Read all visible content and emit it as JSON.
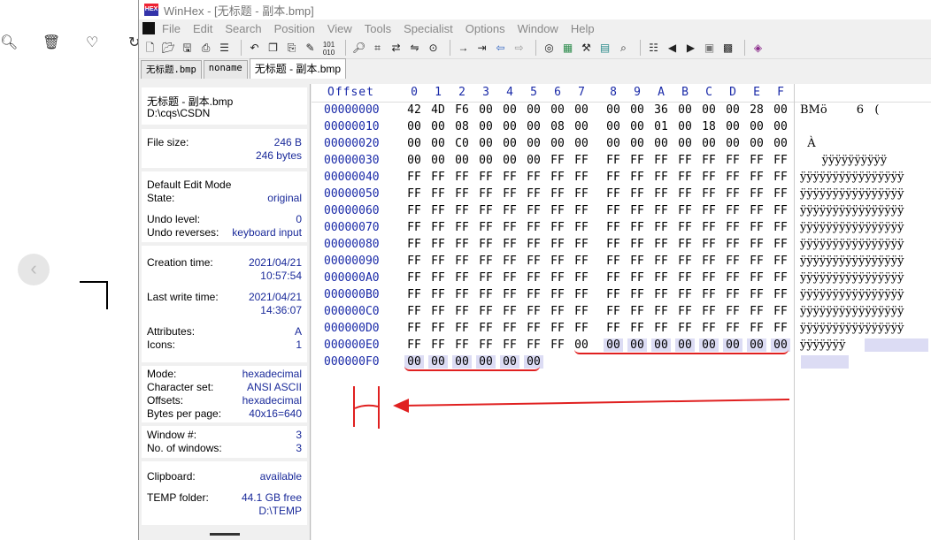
{
  "window": {
    "title": "WinHex - [无标题 - 副本.bmp]"
  },
  "menu": [
    "File",
    "Edit",
    "Search",
    "Position",
    "View",
    "Tools",
    "Specialist",
    "Options",
    "Window",
    "Help"
  ],
  "toolbar_icons": [
    "new-file-icon",
    "open-icon",
    "save-icon",
    "print-icon",
    "properties-icon",
    "undo-icon",
    "copy-icon",
    "paste-icon",
    "write-icon",
    "binary-icon",
    "find-icon",
    "find-hex-icon",
    "replace-icon",
    "replace-hex-icon",
    "find-next-icon",
    "goto-offset-icon",
    "goto-sector-icon",
    "back-icon",
    "forward-icon",
    "disk-icon",
    "ram-icon",
    "tools-icon",
    "calculator-icon",
    "search-icon",
    "hash-icon",
    "prev-icon",
    "next-icon",
    "camera-icon",
    "grid-icon",
    "book-icon"
  ],
  "tabs": [
    "无标题.bmp",
    "noname",
    "无标题 - 副本.bmp"
  ],
  "info": {
    "filename": "无标题 - 副本.bmp",
    "path": "D:\\cqs\\CSDN",
    "file_size_label": "File size:",
    "file_size": "246 B",
    "file_size_bytes": "246 bytes",
    "edit_mode": "Default Edit Mode",
    "state_label": "State:",
    "state": "original",
    "undo_level_label": "Undo level:",
    "undo_level": "0",
    "undo_rev_label": "Undo reverses:",
    "undo_rev": "keyboard input",
    "creation_label": "Creation time:",
    "creation_date": "2021/04/21",
    "creation_time": "10:57:54",
    "lastwrite_label": "Last write time:",
    "lastwrite_date": "2021/04/21",
    "lastwrite_time": "14:36:07",
    "attributes_label": "Attributes:",
    "attributes": "A",
    "icons_label": "Icons:",
    "icons": "1",
    "mode_label": "Mode:",
    "mode": "hexadecimal",
    "charset_label": "Character set:",
    "charset": "ANSI ASCII",
    "offsets_label": "Offsets:",
    "offsets": "hexadecimal",
    "bpp_label": "Bytes per page:",
    "bpp": "40x16=640",
    "window_no_label": "Window #:",
    "window_no": "3",
    "num_windows_label": "No. of windows:",
    "num_windows": "3",
    "clipboard_label": "Clipboard:",
    "clipboard": "available",
    "temp_label": "TEMP folder:",
    "temp_free": "44.1 GB free",
    "temp_path": "D:\\TEMP"
  },
  "hex": {
    "offset_label": "Offset",
    "columns": [
      "0",
      "1",
      "2",
      "3",
      "4",
      "5",
      "6",
      "7",
      "8",
      "9",
      "A",
      "B",
      "C",
      "D",
      "E",
      "F"
    ],
    "rows": [
      {
        "offset": "00000000",
        "bytes": [
          "42",
          "4D",
          "F6",
          "00",
          "00",
          "00",
          "00",
          "00",
          "00",
          "00",
          "36",
          "00",
          "00",
          "00",
          "28",
          "00"
        ],
        "text": "BMö        6   ("
      },
      {
        "offset": "00000010",
        "bytes": [
          "00",
          "00",
          "08",
          "00",
          "00",
          "00",
          "08",
          "00",
          "00",
          "00",
          "01",
          "00",
          "18",
          "00",
          "00",
          "00"
        ],
        "text": ""
      },
      {
        "offset": "00000020",
        "bytes": [
          "00",
          "00",
          "C0",
          "00",
          "00",
          "00",
          "00",
          "00",
          "00",
          "00",
          "00",
          "00",
          "00",
          "00",
          "00",
          "00"
        ],
        "text": "  À"
      },
      {
        "offset": "00000030",
        "bytes": [
          "00",
          "00",
          "00",
          "00",
          "00",
          "00",
          "FF",
          "FF",
          "FF",
          "FF",
          "FF",
          "FF",
          "FF",
          "FF",
          "FF",
          "FF"
        ],
        "text": "      ÿÿÿÿÿÿÿÿÿÿ"
      },
      {
        "offset": "00000040",
        "bytes": [
          "FF",
          "FF",
          "FF",
          "FF",
          "FF",
          "FF",
          "FF",
          "FF",
          "FF",
          "FF",
          "FF",
          "FF",
          "FF",
          "FF",
          "FF",
          "FF"
        ],
        "text": "ÿÿÿÿÿÿÿÿÿÿÿÿÿÿÿÿ"
      },
      {
        "offset": "00000050",
        "bytes": [
          "FF",
          "FF",
          "FF",
          "FF",
          "FF",
          "FF",
          "FF",
          "FF",
          "FF",
          "FF",
          "FF",
          "FF",
          "FF",
          "FF",
          "FF",
          "FF"
        ],
        "text": "ÿÿÿÿÿÿÿÿÿÿÿÿÿÿÿÿ"
      },
      {
        "offset": "00000060",
        "bytes": [
          "FF",
          "FF",
          "FF",
          "FF",
          "FF",
          "FF",
          "FF",
          "FF",
          "FF",
          "FF",
          "FF",
          "FF",
          "FF",
          "FF",
          "FF",
          "FF"
        ],
        "text": "ÿÿÿÿÿÿÿÿÿÿÿÿÿÿÿÿ"
      },
      {
        "offset": "00000070",
        "bytes": [
          "FF",
          "FF",
          "FF",
          "FF",
          "FF",
          "FF",
          "FF",
          "FF",
          "FF",
          "FF",
          "FF",
          "FF",
          "FF",
          "FF",
          "FF",
          "FF"
        ],
        "text": "ÿÿÿÿÿÿÿÿÿÿÿÿÿÿÿÿ"
      },
      {
        "offset": "00000080",
        "bytes": [
          "FF",
          "FF",
          "FF",
          "FF",
          "FF",
          "FF",
          "FF",
          "FF",
          "FF",
          "FF",
          "FF",
          "FF",
          "FF",
          "FF",
          "FF",
          "FF"
        ],
        "text": "ÿÿÿÿÿÿÿÿÿÿÿÿÿÿÿÿ"
      },
      {
        "offset": "00000090",
        "bytes": [
          "FF",
          "FF",
          "FF",
          "FF",
          "FF",
          "FF",
          "FF",
          "FF",
          "FF",
          "FF",
          "FF",
          "FF",
          "FF",
          "FF",
          "FF",
          "FF"
        ],
        "text": "ÿÿÿÿÿÿÿÿÿÿÿÿÿÿÿÿ"
      },
      {
        "offset": "000000A0",
        "bytes": [
          "FF",
          "FF",
          "FF",
          "FF",
          "FF",
          "FF",
          "FF",
          "FF",
          "FF",
          "FF",
          "FF",
          "FF",
          "FF",
          "FF",
          "FF",
          "FF"
        ],
        "text": "ÿÿÿÿÿÿÿÿÿÿÿÿÿÿÿÿ"
      },
      {
        "offset": "000000B0",
        "bytes": [
          "FF",
          "FF",
          "FF",
          "FF",
          "FF",
          "FF",
          "FF",
          "FF",
          "FF",
          "FF",
          "FF",
          "FF",
          "FF",
          "FF",
          "FF",
          "FF"
        ],
        "text": "ÿÿÿÿÿÿÿÿÿÿÿÿÿÿÿÿ"
      },
      {
        "offset": "000000C0",
        "bytes": [
          "FF",
          "FF",
          "FF",
          "FF",
          "FF",
          "FF",
          "FF",
          "FF",
          "FF",
          "FF",
          "FF",
          "FF",
          "FF",
          "FF",
          "FF",
          "FF"
        ],
        "text": "ÿÿÿÿÿÿÿÿÿÿÿÿÿÿÿÿ"
      },
      {
        "offset": "000000D0",
        "bytes": [
          "FF",
          "FF",
          "FF",
          "FF",
          "FF",
          "FF",
          "FF",
          "FF",
          "FF",
          "FF",
          "FF",
          "FF",
          "FF",
          "FF",
          "FF",
          "FF"
        ],
        "text": "ÿÿÿÿÿÿÿÿÿÿÿÿÿÿÿÿ"
      },
      {
        "offset": "000000E0",
        "bytes": [
          "FF",
          "FF",
          "FF",
          "FF",
          "FF",
          "FF",
          "FF",
          "00",
          "00",
          "00",
          "00",
          "00",
          "00",
          "00",
          "00",
          "00"
        ],
        "text": "ÿÿÿÿÿÿÿ"
      },
      {
        "offset": "000000F0",
        "bytes": [
          "00",
          "00",
          "00",
          "00",
          "00",
          "00"
        ],
        "text": ""
      }
    ]
  }
}
